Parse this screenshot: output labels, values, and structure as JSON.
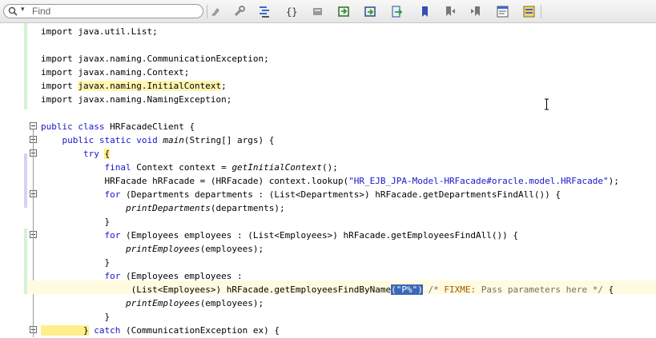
{
  "search": {
    "placeholder": "Find",
    "dropdown": "▾"
  },
  "toolbar": {
    "icons": [
      "toggle-bookmark-icon",
      "wrench-icon",
      "format-icon",
      "braces-icon",
      "shift-left-icon",
      "copy-icon",
      "paste-icon",
      "export-icon",
      "lookup-icon",
      "bookmark-icon",
      "prev-bookmark-icon",
      "next-bookmark-icon",
      "comment-icon",
      "settings-icon"
    ]
  },
  "code": {
    "l1": "import java.util.List;",
    "l3": "import javax.naming.CommunicationException;",
    "l4": "import javax.naming.Context;",
    "l5_a": "import ",
    "l5_b": "javax.naming.InitialContext",
    "l5_c": ";",
    "l6": "import javax.naming.NamingException;",
    "l8_kw": "public class",
    "l8_rest": " HRFacadeClient {",
    "l9_kw": "    public static void",
    "l9_m": "main",
    "l9_rest": "(String[] args) {",
    "l10_kw": "        try",
    "l10_b": "{",
    "l11_kw": "            final",
    "l11_a": " Context context = ",
    "l11_m": "getInitialContext",
    "l11_c": "();",
    "l12_a": "            HRFacade hRFacade = (HRFacade) context.lookup(",
    "l12_s": "\"HR_EJB_JPA-Model-HRFacade#oracle.model.HRFacade\"",
    "l12_c": ");",
    "l13_kw": "            for",
    "l13_rest": " (Departments departments : (List<Departments>) hRFacade.getDepartmentsFindAll()) {",
    "l14_m": "                printDepartments",
    "l14_rest": "(departments);",
    "l15": "            }",
    "l16_kw": "            for",
    "l16_rest": " (Employees employees : (List<Employees>) hRFacade.getEmployeesFindAll()) {",
    "l17_m": "                printEmployees",
    "l17_rest": "(employees);",
    "l18": "            }",
    "l19_kw": "            for",
    "l19_rest": " (Employees employees :",
    "l20_a": "                 (List<Employees>) hRFacade.getEmployeesFindByName",
    "l20_p1": "(",
    "l20_sel": "\"P%\"",
    "l20_p2": ")",
    "l20_c1": " /* ",
    "l20_fx": "FIXME:",
    "l20_c2": " Pass parameters here */",
    "l20_end": " {",
    "l21_m": "                printEmployees",
    "l21_rest": "(employees);",
    "l22": "            }",
    "l23_b": "        }",
    "l23_kw": " catch",
    "l23_rest": " (CommunicationException ex) {"
  }
}
